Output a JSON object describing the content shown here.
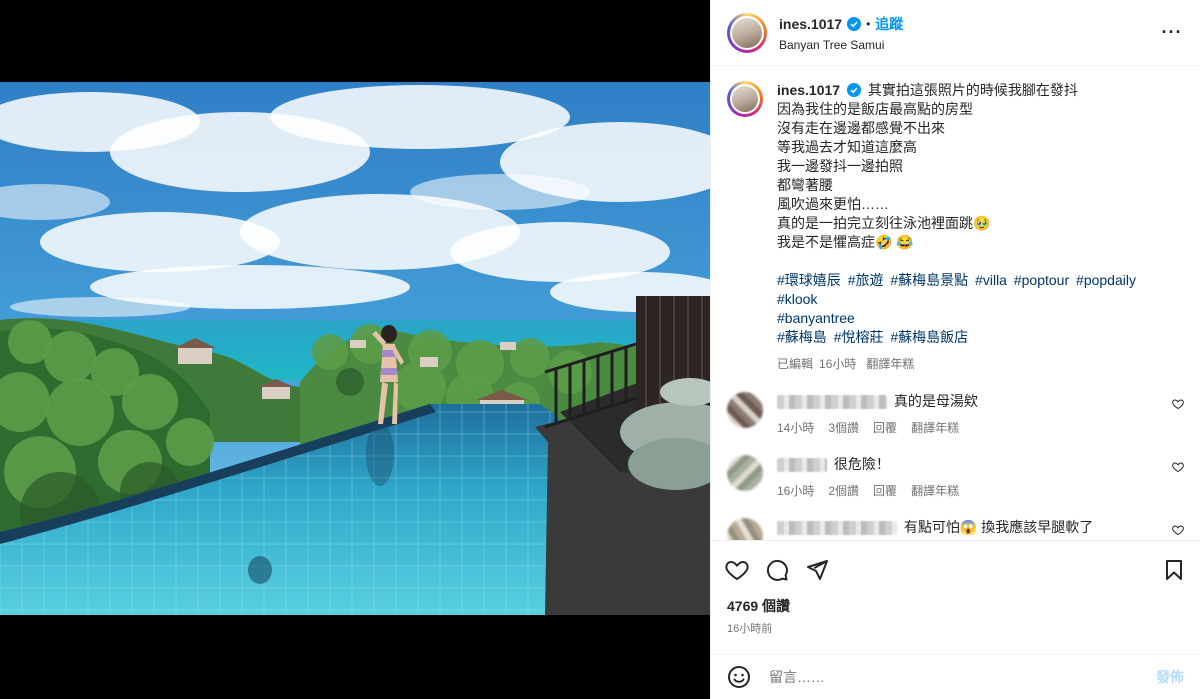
{
  "header": {
    "username": "ines.1017",
    "separator": "•",
    "follow_label": "追蹤",
    "location": "Banyan Tree Samui",
    "more": "···"
  },
  "caption": {
    "username": "ines.1017",
    "lines": [
      "其實拍這張照片的時候我腳在發抖",
      "因為我住的是飯店最高點的房型",
      "沒有走在邊邊都感覺不出來",
      "等我過去才知道這麼高",
      "我一邊發抖一邊拍照",
      "都彎著腰",
      "風吹過來更怕……",
      "真的是一拍完立刻往泳池裡面跳🥹",
      "我是不是懼高症🤣 😂"
    ],
    "hashtags": [
      "#環球嬉辰",
      "#旅遊",
      "#蘇梅島景點",
      "#villa",
      "#poptour",
      "#popdaily",
      "#klook",
      "#banyantree",
      "#蘇梅島",
      "#悅榕莊",
      "#蘇梅島飯店"
    ],
    "meta": {
      "edited": "已編輯",
      "time": "16小時",
      "translate": "翻譯年糕"
    }
  },
  "comments": [
    {
      "text": "真的是母湯欸",
      "time": "14小時",
      "likes": "3個讚",
      "reply": "回覆",
      "translate": "翻譯年糕",
      "avatar_color": "#8a7a72"
    },
    {
      "text": "很危險！",
      "time": "16小時",
      "likes": "2個讚",
      "reply": "回覆",
      "translate": "翻譯年糕",
      "avatar_color": "#a7b1a0"
    },
    {
      "text": "有點可怕😱 換我應該早腿軟了",
      "time": "",
      "likes": "",
      "reply": "",
      "translate": "",
      "avatar_color": "#b8a995"
    }
  ],
  "likes_text": "4769 個讚",
  "posted_text": "16小時前",
  "comment_box": {
    "placeholder": "留言……",
    "post_label": "發佈"
  },
  "colors": {
    "link": "#0095f6",
    "hashtag": "#00376b",
    "muted": "#737373"
  }
}
